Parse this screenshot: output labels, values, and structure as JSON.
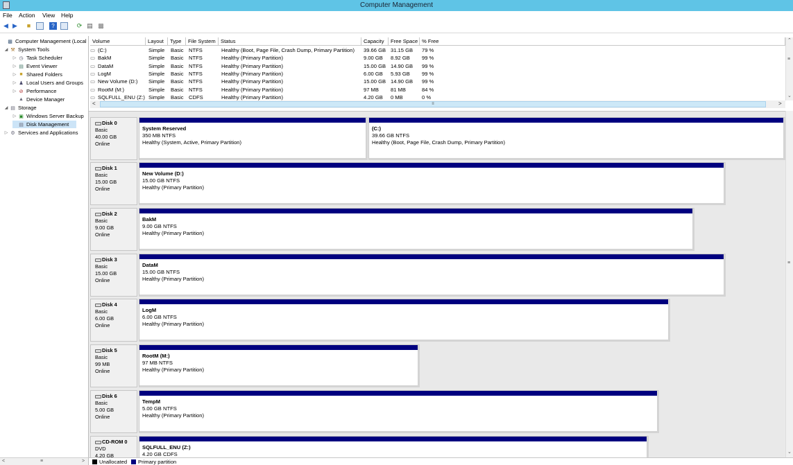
{
  "window": {
    "title": "Computer Management"
  },
  "menu": [
    "File",
    "Action",
    "View",
    "Help"
  ],
  "toolbar": [
    "back-arrow-icon",
    "forward-arrow-icon",
    "up-folder-icon",
    "show-hide-tree-icon",
    "help-icon",
    "console-tree-icon",
    "refresh-icon",
    "properties-icon",
    "disk-settings-icon"
  ],
  "tree": [
    {
      "label": "Computer Management (Local",
      "level": 0,
      "exp": "",
      "icon": "computer-icon"
    },
    {
      "label": "System Tools",
      "level": 1,
      "exp": "◢",
      "icon": "tools-icon"
    },
    {
      "label": "Task Scheduler",
      "level": 2,
      "exp": "▷",
      "icon": "clock-icon"
    },
    {
      "label": "Event Viewer",
      "level": 2,
      "exp": "▷",
      "icon": "event-viewer-icon"
    },
    {
      "label": "Shared Folders",
      "level": 2,
      "exp": "▷",
      "icon": "shared-folder-icon"
    },
    {
      "label": "Local Users and Groups",
      "level": 2,
      "exp": "▷",
      "icon": "users-icon"
    },
    {
      "label": "Performance",
      "level": 2,
      "exp": "▷",
      "icon": "performance-icon"
    },
    {
      "label": "Device Manager",
      "level": 2,
      "exp": "",
      "icon": "device-manager-icon"
    },
    {
      "label": "Storage",
      "level": 1,
      "exp": "◢",
      "icon": "storage-icon"
    },
    {
      "label": "Windows Server Backup",
      "level": 2,
      "exp": "▷",
      "icon": "backup-icon"
    },
    {
      "label": "Disk Management",
      "level": 2,
      "exp": "",
      "icon": "disk-management-icon",
      "selected": true
    },
    {
      "label": "Services and Applications",
      "level": 1,
      "exp": "▷",
      "icon": "services-icon"
    }
  ],
  "volumeList": {
    "columns": [
      "Volume",
      "Layout",
      "Type",
      "File System",
      "Status",
      "Capacity",
      "Free Space",
      "% Free"
    ],
    "rows": [
      [
        "(C:)",
        "Simple",
        "Basic",
        "NTFS",
        "Healthy (Boot, Page File, Crash Dump, Primary Partition)",
        "39.66 GB",
        "31.15 GB",
        "79 %"
      ],
      [
        "BakM",
        "Simple",
        "Basic",
        "NTFS",
        "Healthy (Primary Partition)",
        "9.00 GB",
        "8.92 GB",
        "99 %"
      ],
      [
        "DataM",
        "Simple",
        "Basic",
        "NTFS",
        "Healthy (Primary Partition)",
        "15.00 GB",
        "14.90 GB",
        "99 %"
      ],
      [
        "LogM",
        "Simple",
        "Basic",
        "NTFS",
        "Healthy (Primary Partition)",
        "6.00 GB",
        "5.93 GB",
        "99 %"
      ],
      [
        "New Volume (D:)",
        "Simple",
        "Basic",
        "NTFS",
        "Healthy (Primary Partition)",
        "15.00 GB",
        "14.90 GB",
        "99 %"
      ],
      [
        "RootM (M:)",
        "Simple",
        "Basic",
        "NTFS",
        "Healthy (Primary Partition)",
        "97 MB",
        "81 MB",
        "84 %"
      ],
      [
        "SQLFULL_ENU (Z:)",
        "Simple",
        "Basic",
        "CDFS",
        "Healthy (Primary Partition)",
        "4.20 GB",
        "0 MB",
        "0 %"
      ]
    ]
  },
  "disks": [
    {
      "name": "Disk 0",
      "type": "Basic",
      "size": "40.00 GB",
      "status": "Online",
      "partitions": [
        {
          "name": "System Reserved",
          "size": "350 MB NTFS",
          "status": "Healthy (System, Active, Primary Partition)"
        },
        {
          "name": "(C:)",
          "size": "39.66 GB NTFS",
          "status": "Healthy (Boot, Page File, Crash Dump, Primary Partition)"
        }
      ]
    },
    {
      "name": "Disk 1",
      "type": "Basic",
      "size": "15.00 GB",
      "status": "Online",
      "partitions": [
        {
          "name": "New Volume  (D:)",
          "size": "15.00 GB NTFS",
          "status": "Healthy (Primary Partition)"
        }
      ]
    },
    {
      "name": "Disk 2",
      "type": "Basic",
      "size": "9.00 GB",
      "status": "Online",
      "partitions": [
        {
          "name": "BakM",
          "size": "9.00 GB NTFS",
          "status": "Healthy (Primary Partition)"
        }
      ]
    },
    {
      "name": "Disk 3",
      "type": "Basic",
      "size": "15.00 GB",
      "status": "Online",
      "partitions": [
        {
          "name": "DataM",
          "size": "15.00 GB NTFS",
          "status": "Healthy (Primary Partition)"
        }
      ]
    },
    {
      "name": "Disk 4",
      "type": "Basic",
      "size": "6.00 GB",
      "status": "Online",
      "partitions": [
        {
          "name": "LogM",
          "size": "6.00 GB NTFS",
          "status": "Healthy (Primary Partition)"
        }
      ]
    },
    {
      "name": "Disk 5",
      "type": "Basic",
      "size": "99 MB",
      "status": "Online",
      "partitions": [
        {
          "name": "RootM  (M:)",
          "size": "97 MB NTFS",
          "status": "Healthy (Primary Partition)"
        }
      ]
    },
    {
      "name": "Disk 6",
      "type": "Basic",
      "size": "5.00 GB",
      "status": "Online",
      "partitions": [
        {
          "name": "TempM",
          "size": "5.00 GB NTFS",
          "status": "Healthy (Primary Partition)"
        }
      ]
    },
    {
      "name": "CD-ROM 0",
      "type": "DVD",
      "size": "4.20 GB",
      "status": "",
      "partitions": [
        {
          "name": "SQLFULL_ENU  (Z:)",
          "size": "4.20 GB CDFS",
          "status": ""
        }
      ]
    }
  ],
  "legend": [
    {
      "label": "Unallocated",
      "color": "#000000"
    },
    {
      "label": "Primary partition",
      "color": "#00007f"
    }
  ]
}
